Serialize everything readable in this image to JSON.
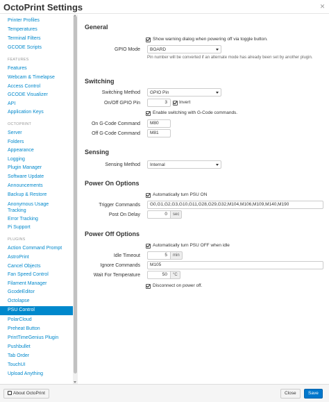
{
  "header": {
    "title": "OctoPrint Settings",
    "close_glyph": "×"
  },
  "sidebar": {
    "items_top": [
      "Printer Profiles",
      "Temperatures",
      "Terminal Filters",
      "GCODE Scripts"
    ],
    "features_header": "FEATURES",
    "features": [
      "Features",
      "Webcam & Timelapse",
      "Access Control",
      "GCODE Visualizer",
      "API",
      "Application Keys"
    ],
    "octoprint_header": "OCTOPRINT",
    "octoprint": [
      "Server",
      "Folders",
      "Appearance",
      "Logging",
      "Plugin Manager",
      "Software Update",
      "Announcements",
      "Backup & Restore",
      "Anonymous Usage Tracking",
      "Error Tracking",
      "Pi Support"
    ],
    "plugins_header": "PLUGINS",
    "plugins": [
      "Action Command Prompt",
      "AstroPrint",
      "Cancel Objects",
      "Fan Speed Control",
      "Filament Manager",
      "GcodeEditor",
      "Octolapse",
      "PSU Control",
      "PolarCloud",
      "Preheat Button",
      "PrintTimeGenius Plugin",
      "Pushbullet",
      "Tab Order",
      "TouchUI",
      "Upload Anything"
    ],
    "active": "PSU Control"
  },
  "general": {
    "heading": "General",
    "warning_label": "Show warning dialog when powering off via toggle button.",
    "gpio_mode_label": "GPIO Mode",
    "gpio_mode_value": "BOARD",
    "gpio_help": "Pin number will be converted if an alternate mode has already been set by another plugin."
  },
  "switching": {
    "heading": "Switching",
    "method_label": "Switching Method",
    "method_value": "GPIO Pin",
    "pin_label": "On/Off GPIO Pin",
    "pin_value": "3",
    "invert_label": "Invert",
    "gcode_label": "Enable switching with G-Code commands.",
    "on_label": "On G-Code Command",
    "on_value": "M80",
    "off_label": "Off G-Code Command",
    "off_value": "M81"
  },
  "sensing": {
    "heading": "Sensing",
    "method_label": "Sensing Method",
    "method_value": "Internal"
  },
  "power_on": {
    "heading": "Power On Options",
    "auto_on_label": "Automatically turn PSU ON",
    "triggers_label": "Trigger Commands",
    "triggers_value": "G0,G1,G2,G3,G10,G11,G28,G29,G32,M104,M106,M109,M140,M190",
    "delay_label": "Post On Delay",
    "delay_value": "0",
    "delay_unit": "sec"
  },
  "power_off": {
    "heading": "Power Off Options",
    "auto_off_label": "Automatically turn PSU OFF when idle",
    "idle_label": "Idle Timeout",
    "idle_value": "5",
    "idle_unit": "min",
    "ignore_label": "Ignore Commands",
    "ignore_value": "M105",
    "temp_label": "Wait For Temperature",
    "temp_value": "50",
    "temp_unit": "°C",
    "disconnect_label": "Disconnect on power off."
  },
  "footer": {
    "about_label": "About OctoPrint",
    "close_label": "Close",
    "save_label": "Save"
  }
}
